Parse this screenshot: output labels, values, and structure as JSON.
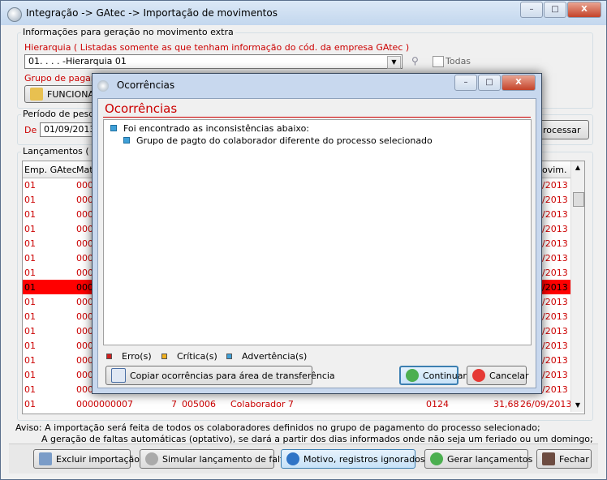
{
  "window": {
    "title": "Integração -> GAtec -> Importação de movimentos",
    "min": "–",
    "max": "□",
    "close": "X"
  },
  "info_group": {
    "label": "Informações para geração no movimento extra",
    "hierarchy_label": "Hierarquia ( Listadas somente as que tenham informação do cód. da empresa GAtec )",
    "hierarchy_value": "01.    .    .    .    -Hierarquia 01",
    "todas_label": "Todas",
    "grupo_label": "Grupo de pagam",
    "grupo_button": "FUNCIONAR"
  },
  "periodo": {
    "label": "Período de pesqu",
    "de_label": "De",
    "de_value": "01/09/2013",
    "processar_label": "rocessar"
  },
  "lancamentos": {
    "label": "Lançamentos ( Mo",
    "headers": {
      "emp": "Emp. GAtec",
      "mat": "Matr",
      "movim": "ovim."
    },
    "rows": [
      {
        "emp": "01",
        "mat": "000",
        "date": "/2013"
      },
      {
        "emp": "01",
        "mat": "000",
        "date": "/2013"
      },
      {
        "emp": "01",
        "mat": "000",
        "date": "/2013"
      },
      {
        "emp": "01",
        "mat": "000",
        "date": "/2013"
      },
      {
        "emp": "01",
        "mat": "000",
        "date": "/2013"
      },
      {
        "emp": "01",
        "mat": "000",
        "date": "/2013"
      },
      {
        "emp": "01",
        "mat": "000",
        "date": "/2013"
      },
      {
        "emp": "01",
        "mat": "000",
        "date": "/2013"
      },
      {
        "emp": "01",
        "mat": "000",
        "date": "/2013"
      },
      {
        "emp": "01",
        "mat": "000",
        "date": "/2013"
      },
      {
        "emp": "01",
        "mat": "000",
        "date": "/2013"
      },
      {
        "emp": "01",
        "mat": "000",
        "date": "/2013"
      },
      {
        "emp": "01",
        "mat": "000",
        "date": "/2013"
      },
      {
        "emp": "01",
        "mat": "000",
        "date": "/2013"
      },
      {
        "emp": "01",
        "mat": "000",
        "date": "/2013"
      }
    ],
    "last_row": {
      "emp": "01",
      "mat": "0000000007",
      "n": "7",
      "code": "005006",
      "name": "Colaborador 7",
      "c": "0124",
      "val": "31,68",
      "date": "26/09/2013"
    }
  },
  "aviso": {
    "line1": "Aviso: A importação será feita de todos os colaboradores definidos no grupo de pagamento do processo selecionado;",
    "line2": "A geração de faltas automáticas (optativo), se dará a partir dos dias informados onde não seja um feriado ou um domingo;"
  },
  "bottom_buttons": {
    "excluir": "Excluir importação",
    "simular": "Simular lançamento de faltas",
    "motivo": "Motivo, registros ignorados",
    "gerar": "Gerar lançamentos",
    "fechar": "Fechar"
  },
  "dialog": {
    "title": "Ocorrências",
    "heading": "Ocorrências",
    "items": [
      "Foi encontrado as inconsistências abaixo:",
      "Grupo de pagto do colaborador diferente do processo selecionado"
    ],
    "legend": {
      "erro": "Erro(s)",
      "critica": "Crítica(s)",
      "advertencia": "Advertência(s)"
    },
    "copy_button": "Copiar ocorrências para área de transferência",
    "continuar": "Continuar",
    "cancelar": "Cancelar"
  },
  "colors": {
    "accent_red": "#cc0000",
    "selected_row": "#ff0000"
  }
}
